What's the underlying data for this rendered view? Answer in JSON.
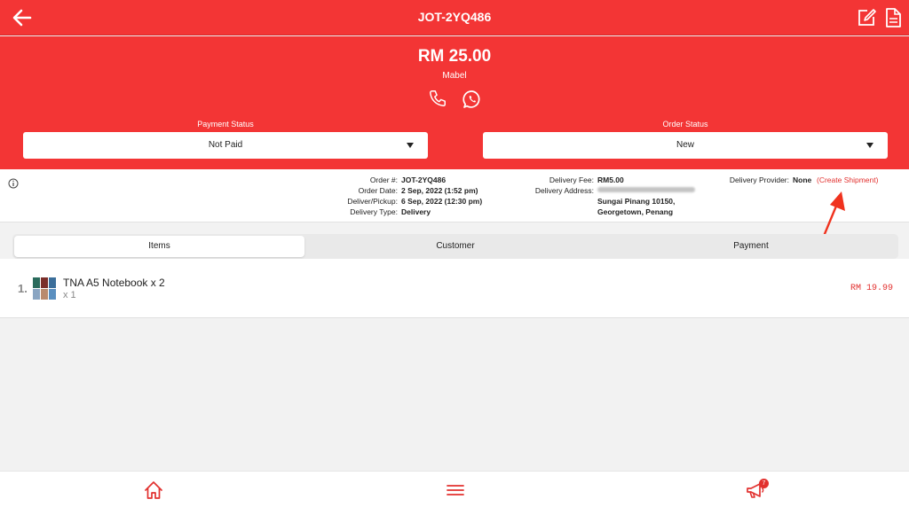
{
  "header": {
    "title": "JOT-2YQ486"
  },
  "summary": {
    "amount": "RM 25.00",
    "customer_name": "Mabel"
  },
  "payment_status": {
    "label": "Payment Status",
    "value": "Not Paid"
  },
  "order_status": {
    "label": "Order Status",
    "value": "New"
  },
  "order_info": {
    "order_no_label": "Order #:",
    "order_no": "JOT-2YQ486",
    "order_date_label": "Order Date:",
    "order_date": "2 Sep, 2022 (1:52 pm)",
    "deliver_label": "Deliver/Pickup:",
    "deliver_date": "6 Sep, 2022 (12:30 pm)",
    "delivery_type_label": "Delivery Type:",
    "delivery_type": "Delivery",
    "fee_label": "Delivery Fee:",
    "fee": "RM5.00",
    "address_label": "Delivery Address:",
    "address_line2": "Sungai Pinang 10150,",
    "address_line3": "Georgetown, Penang",
    "provider_label": "Delivery Provider:",
    "provider": "None",
    "create_shipment": "(Create Shipment)"
  },
  "tabs": [
    {
      "label": "Items",
      "active": true
    },
    {
      "label": "Customer",
      "active": false
    },
    {
      "label": "Payment",
      "active": false
    }
  ],
  "items": [
    {
      "index": "1.",
      "name": "TNA A5 Notebook x 2",
      "qty": "x 1",
      "price": "RM 19.99"
    }
  ],
  "bottom_nav": {
    "notification_count": "7"
  },
  "colors": {
    "brand": "#f33535",
    "accent_text": "#e2312f"
  }
}
